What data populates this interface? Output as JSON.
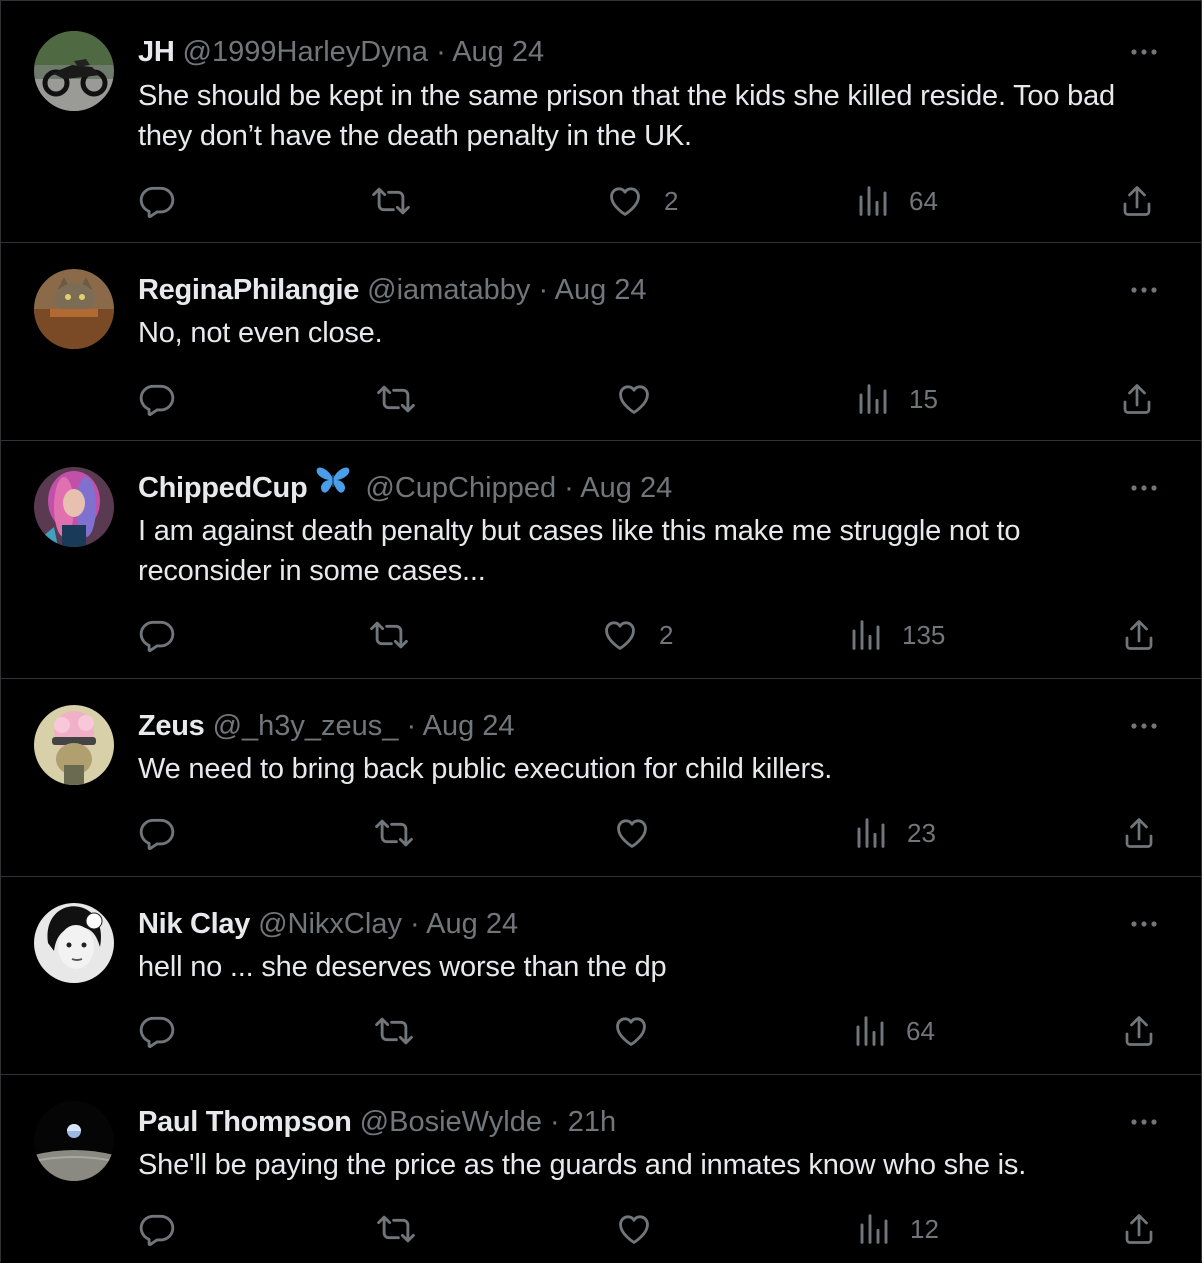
{
  "colors": {
    "background": "#000000",
    "text_primary": "#e7e9ea",
    "text_secondary": "#71767b",
    "divider": "#2f3336"
  },
  "tweets": [
    {
      "name": "JH",
      "handle": "@1999HarleyDyna",
      "time": "Aug 24",
      "badge": null,
      "avatar": "motorcycle-avatar",
      "text": "She should be kept in the same prison that the kids she killed reside. Too bad they don’t have the death penalty in the UK.",
      "likes": "2",
      "views": "64"
    },
    {
      "name": "ReginaPhilangie",
      "handle": "@iamatabby",
      "time": "Aug 24",
      "badge": null,
      "avatar": "tabby-cat-avatar",
      "text": "No, not even close.",
      "likes": "",
      "views": "15"
    },
    {
      "name": "ChippedCup",
      "handle": "@CupChipped",
      "time": "Aug 24",
      "badge": "butterfly-icon",
      "avatar": "colorful-hair-avatar",
      "text": "I am against death penalty but cases like this make me struggle not to reconsider in some cases...",
      "likes": "2",
      "views": "135"
    },
    {
      "name": "Zeus",
      "handle": "@_h3y_zeus_",
      "time": "Aug 24",
      "badge": null,
      "avatar": "cartoon-character-avatar",
      "text": "We need to bring back public execution for child killers.",
      "likes": "",
      "views": "23"
    },
    {
      "name": "Nik Clay",
      "handle": "@NikxClay",
      "time": "Aug 24",
      "badge": null,
      "avatar": "portrait-avatar",
      "text": "hell no ... she deserves worse than the dp",
      "likes": "",
      "views": "64"
    },
    {
      "name": "Paul Thompson",
      "handle": "@BosieWylde",
      "time": "21h",
      "badge": null,
      "avatar": "earthrise-avatar",
      "text": "She'll be paying the price as the guards and inmates know who she is.",
      "likes": "",
      "views": "12"
    }
  ]
}
